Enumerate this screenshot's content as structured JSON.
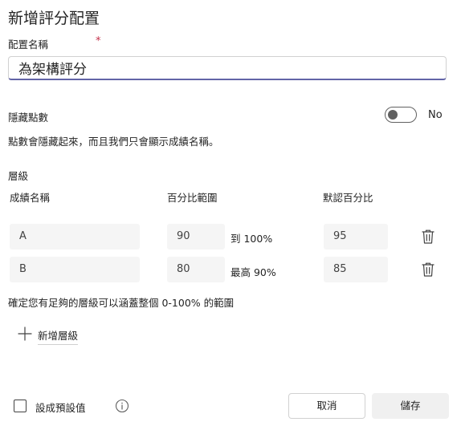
{
  "dialog": {
    "title": "新增評分配置"
  },
  "name_field": {
    "label": "配置名稱",
    "required_mark": "*",
    "value": "為架構評分"
  },
  "hide_points": {
    "label": "隱藏點數",
    "toggle_state": "No",
    "description": "點數會隱藏起來，而且我們只會顯示成績名稱。"
  },
  "levels": {
    "section_label": "層級",
    "headers": {
      "grade_name": "成績名稱",
      "percent_range": "百分比範圍",
      "default_percent": "默認百分比"
    },
    "rows": [
      {
        "grade": "A",
        "range_value": "90",
        "range_suffix": "到 100%",
        "default": "95"
      },
      {
        "grade": "B",
        "range_value": "80",
        "range_suffix": "最高 90%",
        "default": "85"
      }
    ],
    "hint": "確定您有足夠的層級可以涵蓋整個 0-100% 的範圍",
    "add_label": "新增層級"
  },
  "footer": {
    "set_default_label": "設成預設值",
    "cancel_label": "取消",
    "save_label": "儲存"
  },
  "colors": {
    "accent": "#6264a7",
    "required": "#c4314b",
    "field_bg": "#f5f5f5"
  },
  "icons": {
    "trash": "trash-icon",
    "add": "plus-icon",
    "info": "info-icon"
  }
}
